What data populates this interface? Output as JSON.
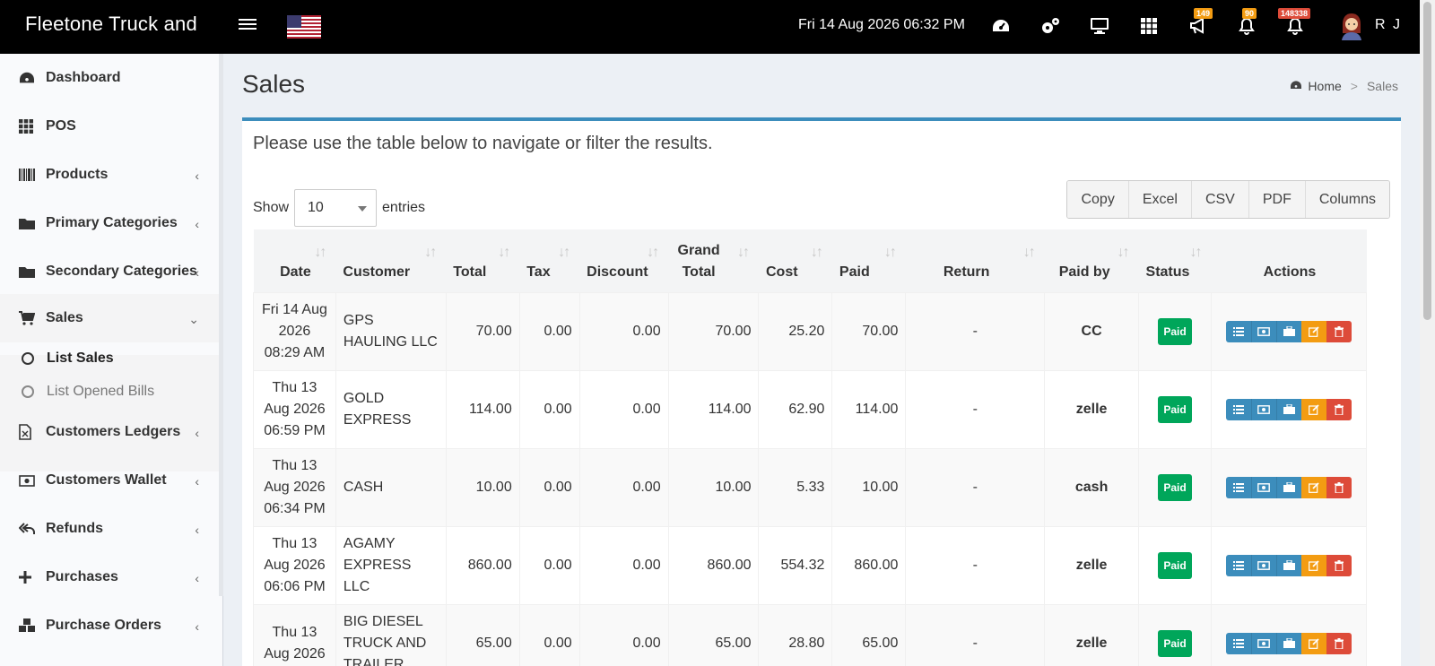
{
  "header": {
    "brand": "Fleetone Truck and",
    "datetime": "Fri 14 Aug 2026 06:32 PM",
    "badges": {
      "announcements": "149",
      "notifications": "90",
      "alerts": "148338"
    },
    "user": "R J"
  },
  "sidebar": {
    "items": [
      {
        "label": "Dashboard",
        "icon": "dashboard-icon"
      },
      {
        "label": "POS",
        "icon": "grid-icon"
      },
      {
        "label": "Products",
        "icon": "barcode-icon"
      },
      {
        "label": "Primary Categories",
        "icon": "folder-icon"
      },
      {
        "label": "Secondary Categories",
        "icon": "folder-icon"
      },
      {
        "label": "Sales",
        "icon": "cart-icon"
      },
      {
        "label": "Customers Ledgers",
        "icon": "file-excel-icon"
      },
      {
        "label": "Customers Wallet",
        "icon": "money-icon"
      },
      {
        "label": "Refunds",
        "icon": "reply-all-icon"
      },
      {
        "label": "Purchases",
        "icon": "plus-icon"
      },
      {
        "label": "Purchase Orders",
        "icon": "cubes-icon"
      }
    ],
    "sales_sub": [
      {
        "label": "List Sales"
      },
      {
        "label": "List Opened Bills"
      }
    ]
  },
  "page": {
    "title": "Sales",
    "breadcrumb": {
      "home": "Home",
      "current": "Sales",
      "separator": ">"
    },
    "intro": "Please use the table below to navigate or filter the results.",
    "show_label": "Show",
    "entries_label": "entries",
    "page_size": "10",
    "buttons": {
      "copy": "Copy",
      "excel": "Excel",
      "csv": "CSV",
      "pdf": "PDF",
      "columns": "Columns"
    }
  },
  "table": {
    "headers": {
      "date": "Date",
      "customer": "Customer",
      "total": "Total",
      "tax": "Tax",
      "discount": "Discount",
      "grand_total": "Grand Total",
      "cost": "Cost",
      "paid": "Paid",
      "return": "Return",
      "paid_by": "Paid by",
      "status": "Status",
      "actions": "Actions"
    },
    "rows": [
      {
        "date": "Fri 14 Aug 2026 08:29 AM",
        "customer": "GPS HAULING LLC",
        "total": "70.00",
        "tax": "0.00",
        "discount": "0.00",
        "grand_total": "70.00",
        "cost": "25.20",
        "paid": "70.00",
        "return": "-",
        "paid_by": "CC",
        "status": "Paid"
      },
      {
        "date": "Thu 13 Aug 2026 06:59 PM",
        "customer": "GOLD EXPRESS",
        "total": "114.00",
        "tax": "0.00",
        "discount": "0.00",
        "grand_total": "114.00",
        "cost": "62.90",
        "paid": "114.00",
        "return": "-",
        "paid_by": "zelle",
        "status": "Paid"
      },
      {
        "date": "Thu 13 Aug 2026 06:34 PM",
        "customer": "CASH",
        "total": "10.00",
        "tax": "0.00",
        "discount": "0.00",
        "grand_total": "10.00",
        "cost": "5.33",
        "paid": "10.00",
        "return": "-",
        "paid_by": "cash",
        "status": "Paid"
      },
      {
        "date": "Thu 13 Aug 2026 06:06 PM",
        "customer": "AGAMY EXPRESS LLC",
        "total": "860.00",
        "tax": "0.00",
        "discount": "0.00",
        "grand_total": "860.00",
        "cost": "554.32",
        "paid": "860.00",
        "return": "-",
        "paid_by": "zelle",
        "status": "Paid"
      },
      {
        "date": "Thu 13 Aug 2026",
        "customer": "BIG DIESEL TRUCK AND TRAILER",
        "total": "65.00",
        "tax": "0.00",
        "discount": "0.00",
        "grand_total": "65.00",
        "cost": "28.80",
        "paid": "65.00",
        "return": "-",
        "paid_by": "zelle",
        "status": "Paid"
      }
    ]
  },
  "colors": {
    "topbar": "#000000",
    "accent": "#3c8dbc",
    "paid_badge": "#00a65a",
    "edit": "#f39c12",
    "delete": "#dd4b39"
  }
}
